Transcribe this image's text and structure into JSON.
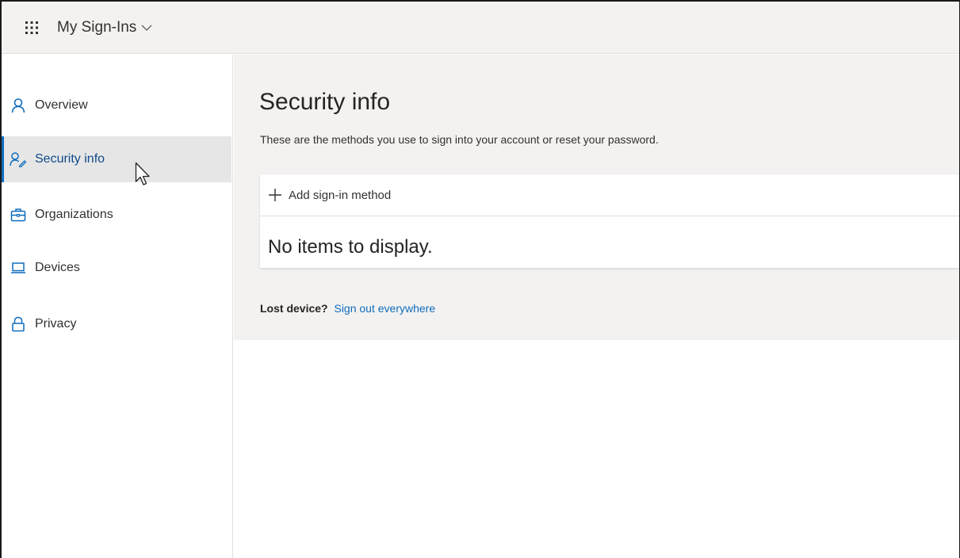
{
  "header": {
    "app_title": "My Sign-Ins",
    "waffle_icon": "app-launcher-icon",
    "chevron_icon": "chevron-down-icon"
  },
  "sidebar": {
    "items": [
      {
        "label": "Overview",
        "icon": "person-icon",
        "active": false
      },
      {
        "label": "Security info",
        "icon": "security-person-icon",
        "active": true
      },
      {
        "label": "Organizations",
        "icon": "briefcase-icon",
        "active": false
      },
      {
        "label": "Devices",
        "icon": "laptop-icon",
        "active": false
      },
      {
        "label": "Privacy",
        "icon": "lock-icon",
        "active": false
      }
    ]
  },
  "main": {
    "title": "Security info",
    "subtitle": "These are the methods you use to sign into your account or reset your password.",
    "add_method_label": "Add sign-in method",
    "empty_message": "No items to display.",
    "lost_device_label": "Lost device?",
    "sign_out_link": "Sign out everywhere"
  },
  "colors": {
    "accent": "#0f6cbd",
    "active_text": "#0f4a8a",
    "topbar_bg": "#f3f2f1",
    "active_bg": "#e6e6e6"
  }
}
